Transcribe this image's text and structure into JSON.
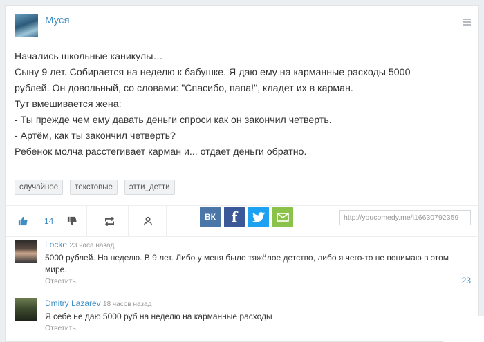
{
  "post": {
    "author": "Муся",
    "lines": [
      "Начались школьные каникулы…",
      "Сыну 9 лет. Собирается на неделю к бабушке. Я даю ему на карманные расходы 5000",
      "рублей. Он довольный, со словами: \"Спасибо, папа!\", кладет их в карман.",
      "Тут вмешивается жена:",
      "- Ты прежде чем ему давать деньги спроси как он закончил четверть.",
      "- Артём, как ты закончил четверть?",
      "Ребенок молча расстегивает карман и... отдает деньги обратно."
    ],
    "tags": [
      "случайное",
      "текстовые",
      "этти_детти"
    ]
  },
  "actions": {
    "like_count": "14",
    "share_url": "http://youcomedy.me/i16630792359"
  },
  "social": {
    "vk_label": "ВК",
    "fb_label": "f",
    "vk_color": "#4a76a8",
    "fb_color": "#3b5998",
    "tw_color": "#1da1f2",
    "mail_color": "#8bc34a"
  },
  "comments": [
    {
      "name": "Locke",
      "time": "23 часа назад",
      "text": "5000 рублей. На неделю. В 9 лет. Либо у меня было тяжёлое детство, либо я чего-то не понимаю в этом мире.",
      "reply": "Ответить",
      "count": "23"
    },
    {
      "name": "Dmitry Lazarev",
      "time": "18 часов назад",
      "text": "Я себе не даю 5000 руб на неделю на карманные расходы",
      "reply": "Ответить"
    }
  ]
}
